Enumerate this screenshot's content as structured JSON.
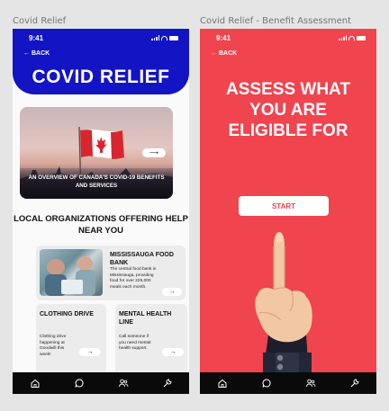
{
  "frames": [
    {
      "label": "Covid Relief"
    },
    {
      "label": "Covid Relief - Benefit Assessment"
    }
  ],
  "status": {
    "time": "9:41"
  },
  "back_label": "BACK",
  "covid_relief": {
    "title": "COVID RELIEF",
    "banner": {
      "text": "AN OVERVIEW OF CANADA'S COVID-19 BENEFITS AND SERVICES",
      "arrow": "⟶"
    },
    "section_title": "LOCAL ORGANIZATIONS OFFERING HELP NEAR YOU",
    "cards": [
      {
        "title": "MISSISSAUGA FOOD BANK",
        "body": "The central food bank in Mississauga, providing food for over 225,000 meals each month.",
        "arrow": "→"
      },
      {
        "title": "CLOTHING DRIVE",
        "body": "Clothing drive happening at Goodwill this week!",
        "arrow": "→"
      },
      {
        "title": "MENTAL HEALTH LINE",
        "body": "Call someone if you need mental health support.",
        "arrow": "→"
      }
    ]
  },
  "assessment": {
    "title": "ASSESS WHAT YOU ARE ELIGIBLE FOR",
    "start_label": "START"
  },
  "tabbar": {
    "icons": [
      "home-icon",
      "chat-icon",
      "people-icon",
      "wrench-icon"
    ]
  },
  "colors": {
    "primary_blue": "#1314c4",
    "assessment_red": "#f0444f",
    "tabbar": "#0a0a0a"
  }
}
